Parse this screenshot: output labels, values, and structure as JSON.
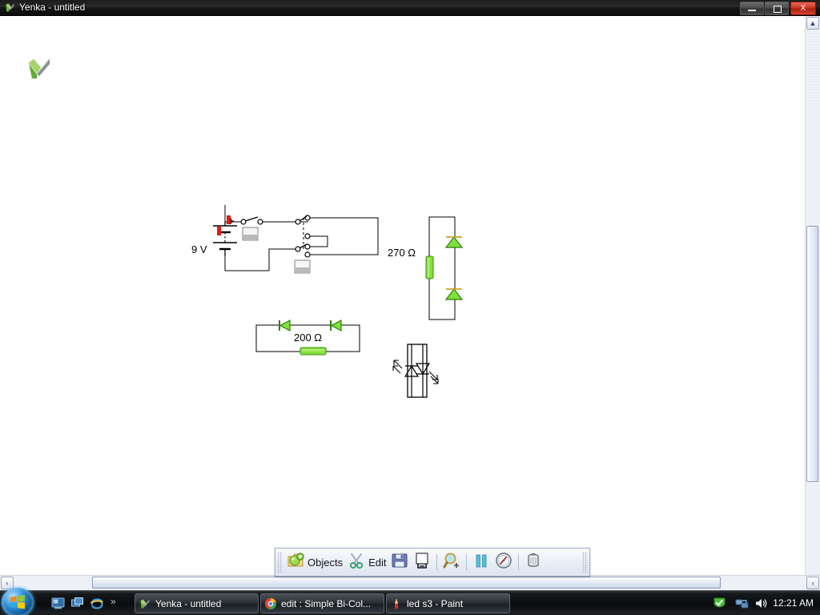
{
  "window": {
    "title": "Yenka - untitled",
    "icon": "yenka-logo-icon",
    "minimize_label": "",
    "maximize_label": "",
    "close_label": "X"
  },
  "canvas": {
    "logo": "yenka-logo",
    "labels": {
      "battery_voltage": "9 V",
      "resistor_270": "270 Ω",
      "resistor_200": "200 Ω"
    },
    "components": [
      {
        "name": "battery",
        "label": "9 V",
        "type": "cell-battery"
      },
      {
        "name": "push-switch",
        "label": "",
        "type": "switch"
      },
      {
        "name": "dpdt-switch",
        "label": "",
        "type": "double-pole-double-throw-switch"
      },
      {
        "name": "resistor-270",
        "label": "270 Ω",
        "type": "resistor"
      },
      {
        "name": "led-upper",
        "label": "",
        "type": "led"
      },
      {
        "name": "led-lower",
        "label": "",
        "type": "led"
      },
      {
        "name": "resistor-200",
        "label": "200 Ω",
        "type": "resistor"
      },
      {
        "name": "diode-left",
        "label": "",
        "type": "diode"
      },
      {
        "name": "diode-right",
        "label": "",
        "type": "diode"
      },
      {
        "name": "bicolour-led",
        "label": "",
        "type": "bi-colour-led"
      }
    ]
  },
  "toolbar": {
    "objects_label": "Objects",
    "objects_icon": "objects-add-icon",
    "edit_label": "Edit",
    "edit_icon": "scissors-icon",
    "save_icon": "save-floppy-icon",
    "saveas_icon": "save-as-icon",
    "zoom_icon": "zoom-in-magnifier-icon",
    "pause_icon": "pause-icon",
    "meter_icon": "gauge-meter-icon",
    "delete_icon": "trash-bin-icon"
  },
  "scrollbars": {
    "vertical_up": "▲",
    "vertical_down": "▼",
    "horizontal_left": "‹",
    "horizontal_right": "›"
  },
  "taskbar": {
    "start_label": "",
    "quicklaunch": [
      {
        "name": "show-desktop-icon"
      },
      {
        "name": "switch-windows-icon"
      },
      {
        "name": "internet-explorer-icon"
      }
    ],
    "overflow_label": "»",
    "buttons": [
      {
        "name": "taskbar-button-yenka",
        "label": "Yenka - untitled",
        "icon": "yenka-logo-icon",
        "active": true
      },
      {
        "name": "taskbar-button-chrome",
        "label": "edit : Simple Bi-Col...",
        "icon": "chrome-icon",
        "active": false
      },
      {
        "name": "taskbar-button-paint",
        "label": "led s3 - Paint",
        "icon": "paint-icon",
        "active": false
      }
    ],
    "tray": [
      {
        "name": "action-center-icon"
      },
      {
        "name": "network-icon"
      },
      {
        "name": "volume-icon"
      }
    ],
    "clock": "12:21 AM"
  },
  "colors": {
    "led_green": "#7ee03a",
    "resistor_green": "#86e03c",
    "terminal_red": "#e01b12",
    "close_red": "#c9301d",
    "wire_black": "#000000"
  }
}
